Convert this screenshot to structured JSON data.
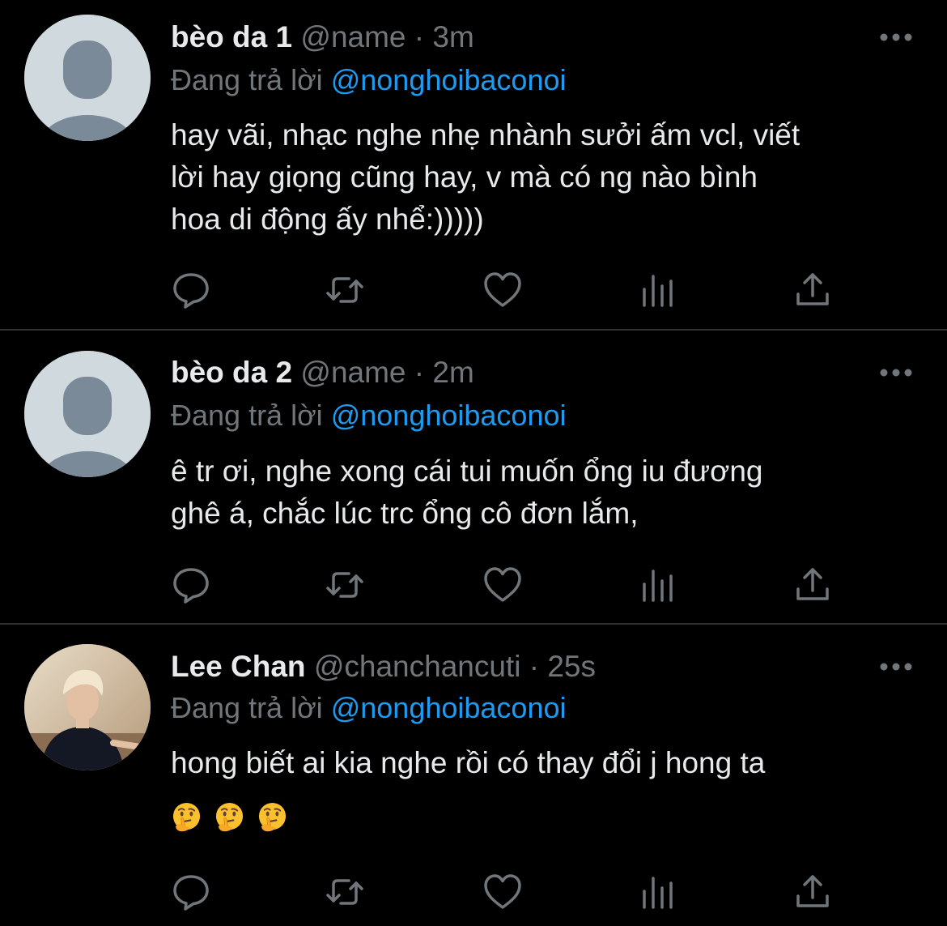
{
  "reply_prefix": "Đang trả lời",
  "tweets": [
    {
      "display_name": "bèo da 1",
      "handle": "@name",
      "separator": "·",
      "time": "3m",
      "replying_to": "@nonghoibaconoi",
      "text": "hay vãi, nhạc nghe nhẹ nhành sưởi ấm vcl, viết\nlời hay giọng cũng hay, v mà có ng nào bình\nhoa di động ấy nhể:)))))",
      "avatar": "default-avatar-icon"
    },
    {
      "display_name": "bèo da 2",
      "handle": "@name",
      "separator": "·",
      "time": "2m",
      "replying_to": "@nonghoibaconoi",
      "text": "ê tr ơi, nghe xong cái tui muốn ổng iu đương\nghê á, chắc lúc trc ổng cô đơn lắm,",
      "avatar": "default-avatar-icon"
    },
    {
      "display_name": "Lee Chan",
      "handle": "@chanchancuti",
      "separator": "·",
      "time": "25s",
      "replying_to": "@nonghoibaconoi",
      "text": "hong biết ai kia nghe rồi có thay đổi j hong ta",
      "emojis": [
        "thinking-face-emoji",
        "thinking-face-emoji",
        "thinking-face-emoji"
      ],
      "avatar": "profile-photo"
    }
  ],
  "icons": {
    "more": "more-dots-icon",
    "reply": "reply-icon",
    "retweet": "retweet-icon",
    "like": "heart-icon",
    "views": "analytics-icon",
    "share": "share-icon"
  },
  "colors": {
    "background": "#000000",
    "text": "#e7e9ea",
    "secondary": "#71767b",
    "accent": "#1d9bf0",
    "divider": "#2f3336",
    "avatar_bg": "#cfd9de",
    "avatar_fg": "#7b8a99"
  }
}
